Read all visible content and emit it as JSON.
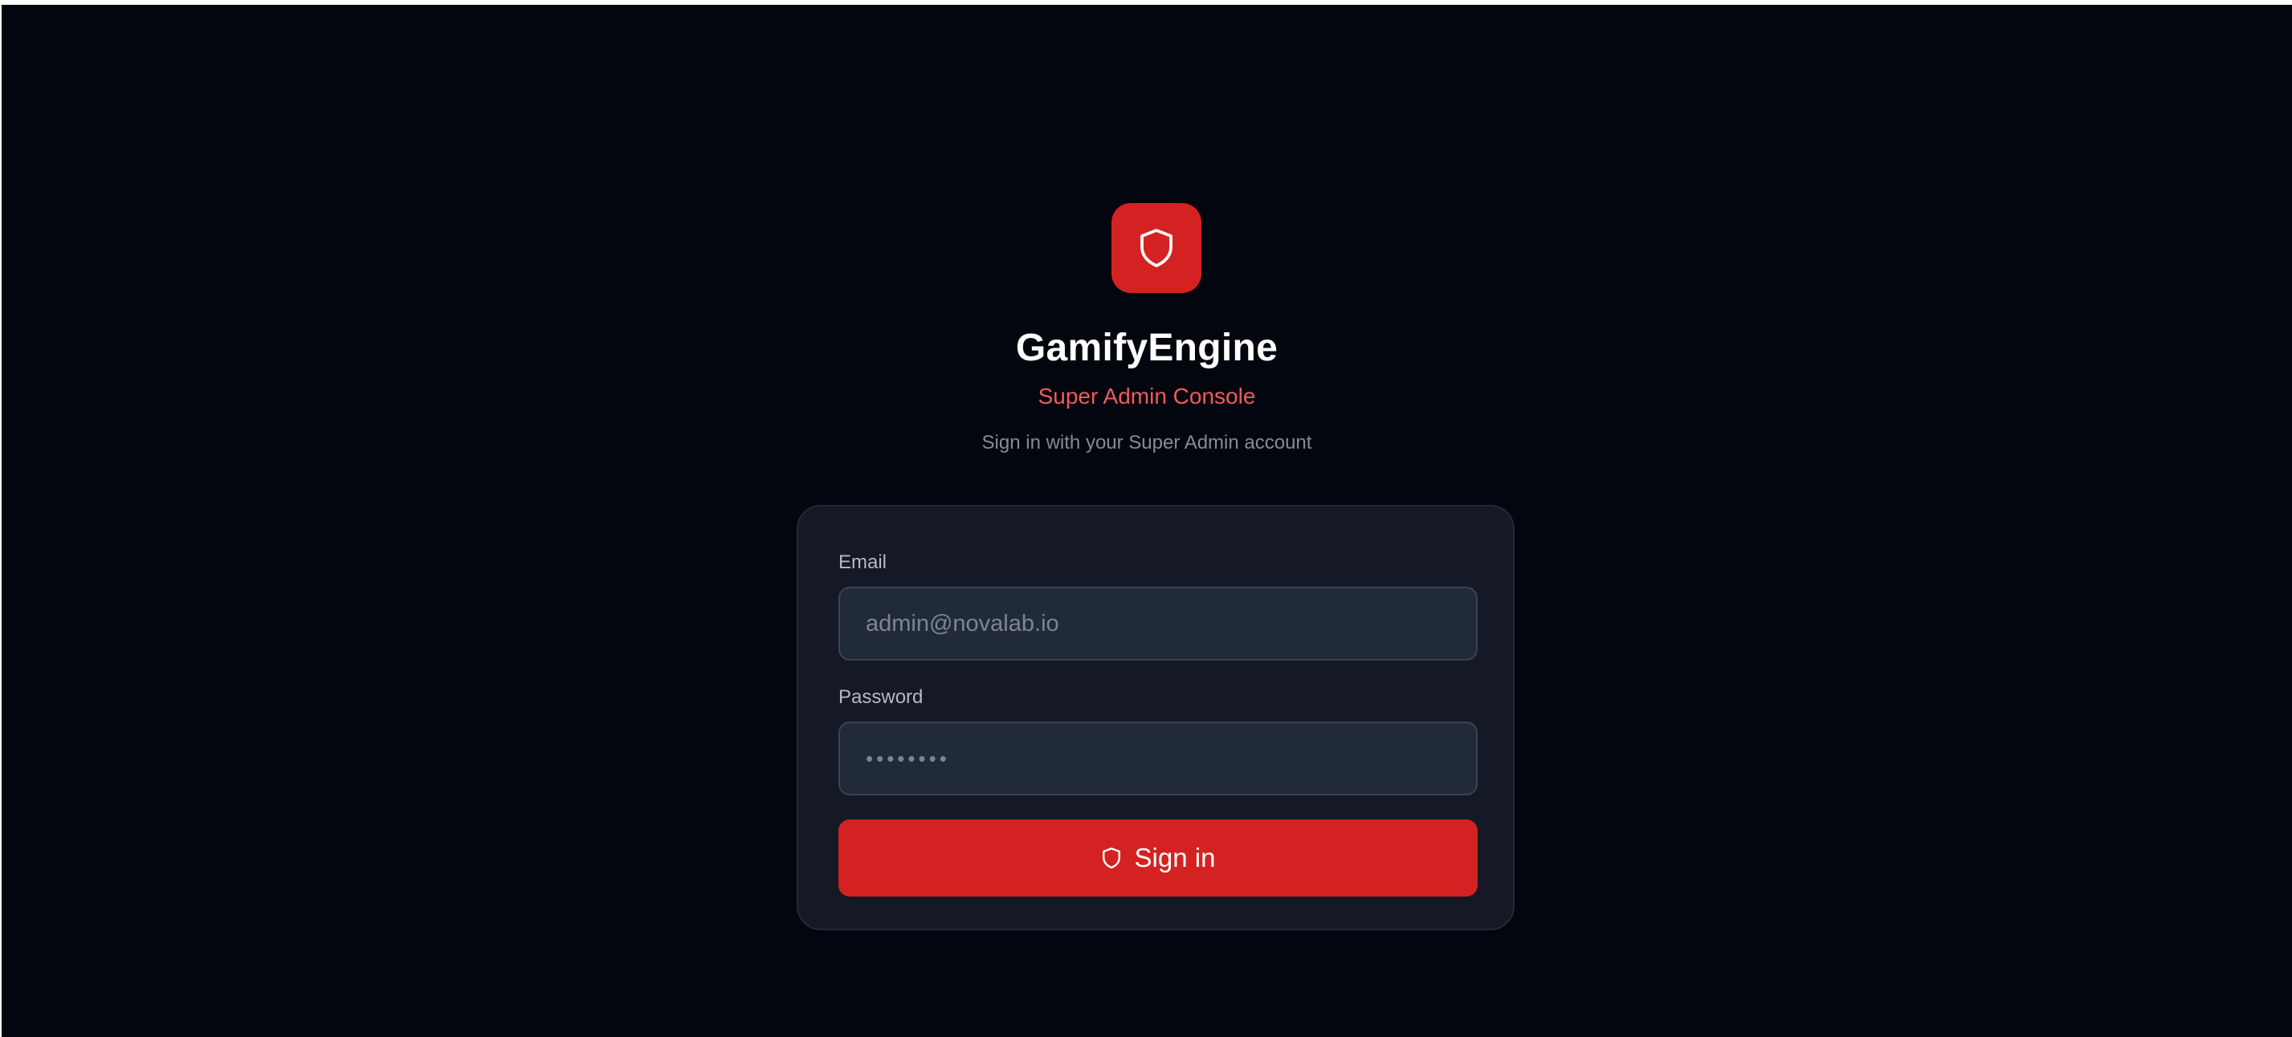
{
  "app": {
    "name": "GamifyEngine",
    "subtitle": "Super Admin Console",
    "hint": "Sign in with your Super Admin account",
    "logo_icon": "shield-icon"
  },
  "form": {
    "email": {
      "label": "Email",
      "placeholder": "admin@novalab.io",
      "value": ""
    },
    "password": {
      "label": "Password",
      "placeholder": "••••••••",
      "value": ""
    },
    "submit": {
      "label": "Sign in",
      "icon": "shield-icon"
    }
  },
  "colors": {
    "background": "#03060f",
    "card": "#141925",
    "accent": "#d42222",
    "subtitle": "#f15a5a",
    "input": "#212a39"
  }
}
